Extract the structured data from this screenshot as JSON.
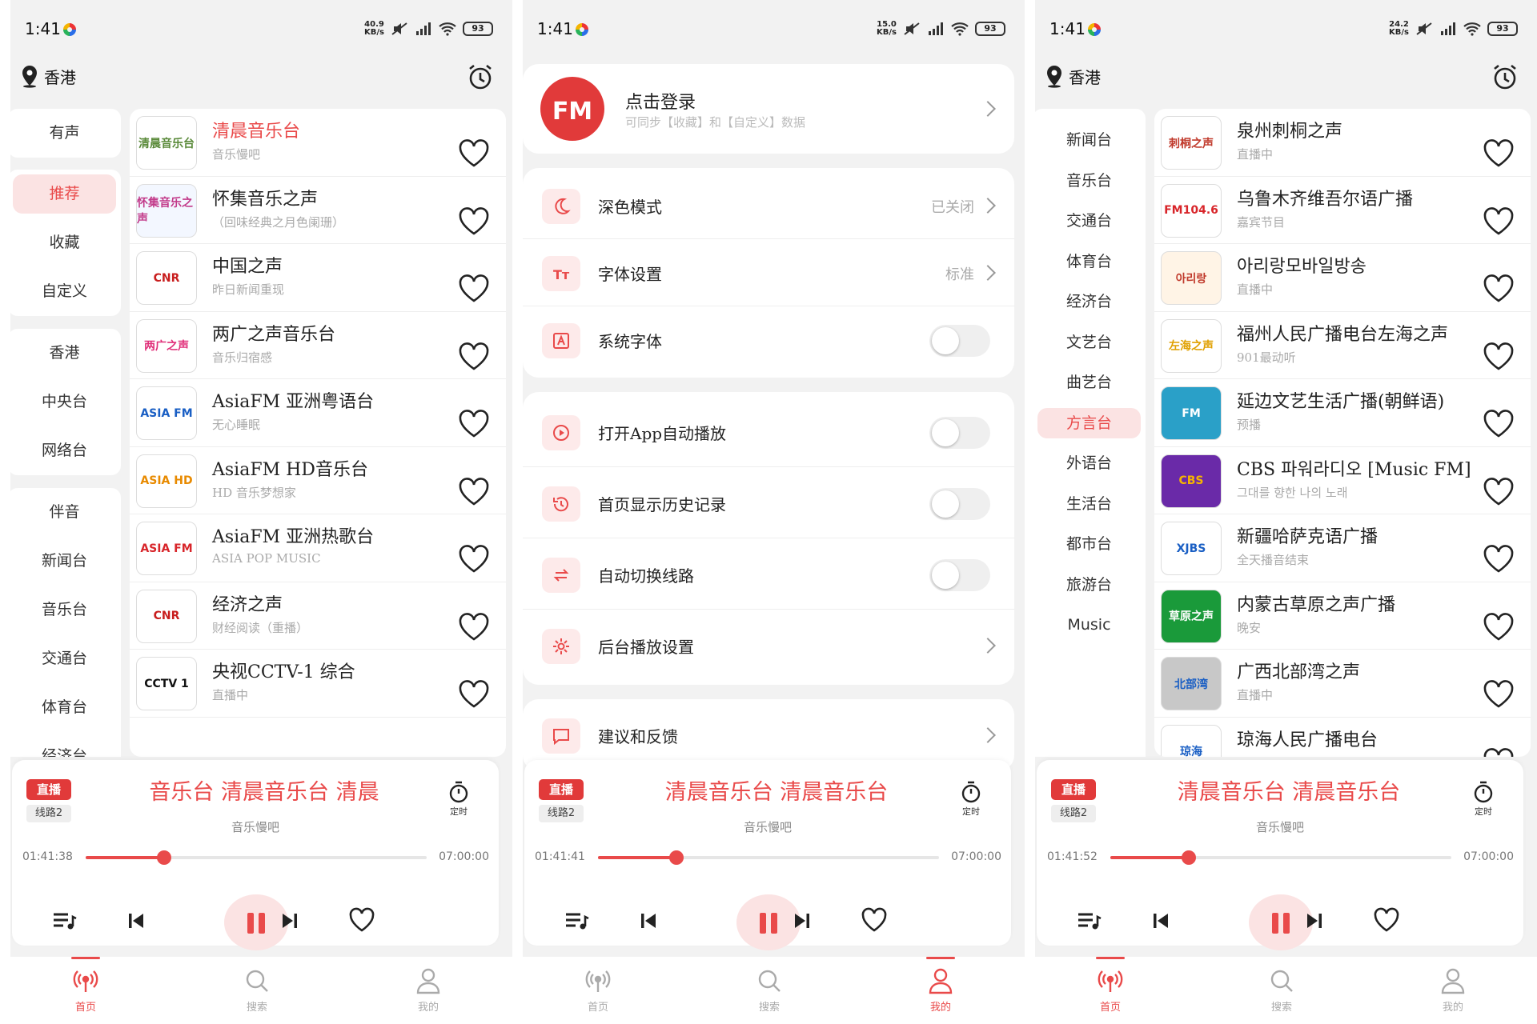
{
  "status_bars": [
    {
      "time": "1:41",
      "speed_value": "40.9",
      "speed_unit": "KB/s",
      "battery": "93"
    },
    {
      "time": "1:41",
      "speed_value": "15.0",
      "speed_unit": "KB/s",
      "battery": "93"
    },
    {
      "time": "1:41",
      "speed_value": "24.2",
      "speed_unit": "KB/s",
      "battery": "93"
    }
  ],
  "location": "香港",
  "screen1": {
    "categories": [
      {
        "items": [
          "有声"
        ]
      },
      {
        "items": [
          "推荐",
          "收藏",
          "自定义"
        ]
      },
      {
        "items": [
          "香港",
          "中央台",
          "网络台"
        ]
      },
      {
        "items": [
          "伴音",
          "新闻台",
          "音乐台",
          "交通台",
          "体育台",
          "经济台"
        ]
      }
    ],
    "active_category": "推荐",
    "stations": [
      {
        "name": "清晨音乐台",
        "sub": "音乐慢吧",
        "logo": "清晨音乐台",
        "playing": true,
        "logo_color": "#5a8a3a",
        "logo_bg": "#fff"
      },
      {
        "name": "怀集音乐之声",
        "sub": "（回味经典之月色阑珊）",
        "logo": "怀集音乐之声",
        "playing": false,
        "logo_color": "#c23a8a",
        "logo_bg": "#f3f7ff"
      },
      {
        "name": "中国之声",
        "sub": "昨日新闻重现",
        "logo": "CNR",
        "playing": false,
        "logo_color": "#c81d1d",
        "logo_bg": "#fff"
      },
      {
        "name": "两广之声音乐台",
        "sub": "音乐归宿感",
        "logo": "两广之声",
        "playing": false,
        "logo_color": "#e0307a",
        "logo_bg": "#fff"
      },
      {
        "name": "AsiaFM 亚洲粤语台",
        "sub": "无心睡眠",
        "logo": "ASIA FM",
        "playing": false,
        "logo_color": "#1a5fc4",
        "logo_bg": "#fff"
      },
      {
        "name": "AsiaFM HD音乐台",
        "sub": "HD 音乐梦想家",
        "logo": "ASIA HD",
        "playing": false,
        "logo_color": "#e88a00",
        "logo_bg": "#fff"
      },
      {
        "name": "AsiaFM 亚洲热歌台",
        "sub": "ASIA POP MUSIC",
        "logo": "ASIA FM",
        "playing": false,
        "logo_color": "#d8252a",
        "logo_bg": "#fff"
      },
      {
        "name": "经济之声",
        "sub": "财经阅读（重播）",
        "logo": "CNR",
        "playing": false,
        "logo_color": "#c81d1d",
        "logo_bg": "#fff"
      },
      {
        "name": "央视CCTV-1 综合",
        "sub": "直播中",
        "logo": "CCTV 1",
        "playing": false,
        "logo_color": "#111",
        "logo_bg": "#fff"
      }
    ],
    "marquee": "音乐台  清晨音乐台  清晨"
  },
  "screen2": {
    "login_title": "点击登录",
    "login_sub": "可同步【收藏】和【自定义】数据",
    "login_logo": "FM",
    "group1": [
      {
        "label": "深色模式",
        "value": "已关闭",
        "type": "link",
        "icon": "moon-icon"
      },
      {
        "label": "字体设置",
        "value": "标准",
        "type": "link",
        "icon": "font-size-icon"
      },
      {
        "label": "系统字体",
        "value": "",
        "type": "toggle",
        "icon": "font-box-icon"
      }
    ],
    "group2": [
      {
        "label": "打开App自动播放",
        "value": "",
        "type": "toggle",
        "icon": "play-circle-icon"
      },
      {
        "label": "首页显示历史记录",
        "value": "",
        "type": "toggle",
        "icon": "history-icon"
      },
      {
        "label": "自动切换线路",
        "value": "",
        "type": "toggle",
        "icon": "switch-icon"
      },
      {
        "label": "后台播放设置",
        "value": "",
        "type": "link",
        "icon": "gear-icon"
      }
    ],
    "group3": [
      {
        "label": "建议和反馈",
        "value": "",
        "type": "link",
        "icon": "feedback-icon"
      }
    ],
    "marquee": "清晨音乐台  清晨音乐台"
  },
  "screen3": {
    "categories": [
      "新闻台",
      "音乐台",
      "交通台",
      "体育台",
      "经济台",
      "文艺台",
      "曲艺台",
      "方言台",
      "外语台",
      "生活台",
      "都市台",
      "旅游台",
      "Music"
    ],
    "active_category": "方言台",
    "stations": [
      {
        "name": "泉州刺桐之声",
        "sub": "直播中",
        "logo": "刺桐之声",
        "logo_color": "#c0392b",
        "logo_bg": "#fff"
      },
      {
        "name": "乌鲁木齐维吾尔语广播",
        "sub": "嘉宾节目",
        "logo": "FM104.6",
        "logo_color": "#d8252a",
        "logo_bg": "#fff"
      },
      {
        "name": "아리랑모바일방송",
        "sub": "直播中",
        "logo": "아리랑",
        "logo_color": "#c0392b",
        "logo_bg": "#fff4e6"
      },
      {
        "name": "福州人民广播电台左海之声",
        "sub": "901最动听",
        "logo": "左海之声",
        "logo_color": "#e0a000",
        "logo_bg": "#fff"
      },
      {
        "name": "延边文艺生活广播(朝鲜语)",
        "sub": "预播",
        "logo": "FM",
        "logo_color": "#fff",
        "logo_bg": "#2aa0c8"
      },
      {
        "name": "CBS 파워라디오 [Music FM]",
        "sub": "그대를 향한 나의 노래",
        "logo": "CBS",
        "logo_color": "#f5b400",
        "logo_bg": "#6a2aa8"
      },
      {
        "name": "新疆哈萨克语广播",
        "sub": "全天播音结束",
        "logo": "XJBS",
        "logo_color": "#1a5fc4",
        "logo_bg": "#fff"
      },
      {
        "name": "内蒙古草原之声广播",
        "sub": "晚安",
        "logo": "草原之声",
        "logo_color": "#fff",
        "logo_bg": "#1a9a3a"
      },
      {
        "name": "广西北部湾之声",
        "sub": "直播中",
        "logo": "北部湾",
        "logo_color": "#1a5fc4",
        "logo_bg": "#c8c8c8"
      },
      {
        "name": "琼海人民广播电台",
        "sub": "",
        "logo": "琼海",
        "logo_color": "#1a5fc4",
        "logo_bg": "#fff"
      }
    ],
    "marquee": "清晨音乐台  清晨音乐台"
  },
  "player": {
    "live": "直播",
    "line": "线路2",
    "sub": "音乐慢吧",
    "timer_label": "定时",
    "end_time": "07:00:00",
    "current_times": [
      "01:41:38",
      "01:41:41",
      "01:41:52"
    ],
    "progress": 0.23
  },
  "nav": [
    "首页",
    "搜索",
    "我的"
  ],
  "colors": {
    "accent": "#e94a4a",
    "accent_light": "#fbe3e3"
  }
}
